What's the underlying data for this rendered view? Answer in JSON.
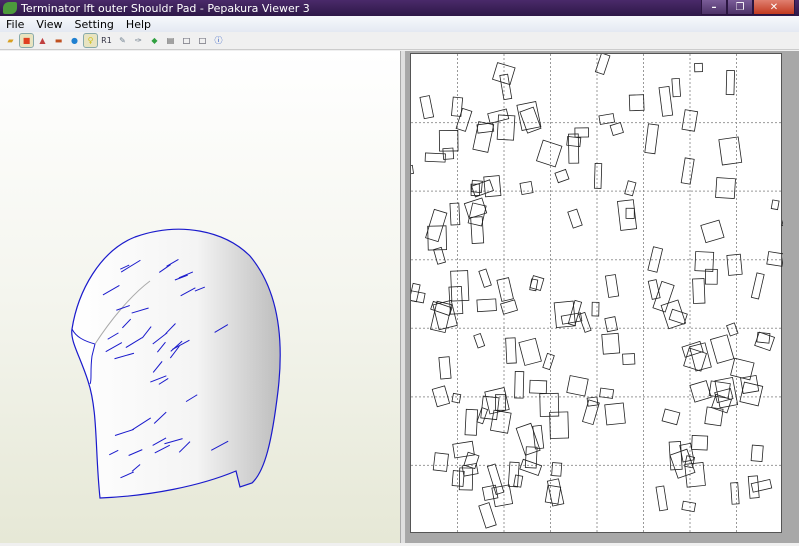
{
  "window": {
    "title": "Terminator lft outer Shouldr Pad - Pepakura Viewer 3",
    "minimize": "–",
    "maximize": "❐",
    "close": "✕"
  },
  "menu": [
    "File",
    "View",
    "Setting",
    "Help"
  ],
  "toolbar": [
    {
      "icon": "open-folder-icon",
      "glyph": "▰",
      "color": "#d9a020"
    },
    {
      "icon": "3d-view-icon",
      "glyph": "■",
      "color": "#e04020",
      "active": true
    },
    {
      "icon": "print-icon",
      "glyph": "▲",
      "color": "#c04040"
    },
    {
      "icon": "layout-icon",
      "glyph": "▬",
      "color": "#c05020"
    },
    {
      "icon": "texture-icon",
      "glyph": "●",
      "color": "#2080d0"
    },
    {
      "icon": "light-bulb-icon",
      "glyph": "♀",
      "color": "#d0c020",
      "active": true
    },
    {
      "icon": "r1-icon",
      "glyph": "R1",
      "color": "#334"
    },
    {
      "icon": "settings-icon",
      "glyph": "✎",
      "color": "#708090"
    },
    {
      "icon": "wrench-icon",
      "glyph": "✑",
      "color": "#607080"
    },
    {
      "icon": "select-icon",
      "glyph": "◆",
      "color": "#30a040"
    },
    {
      "icon": "printer-icon",
      "glyph": "▤",
      "color": "#555"
    },
    {
      "icon": "page-icon",
      "glyph": "□",
      "color": "#334"
    },
    {
      "icon": "page2-icon",
      "glyph": "□",
      "color": "#334"
    },
    {
      "icon": "info-icon",
      "glyph": "ⓘ",
      "color": "#2050c0"
    }
  ],
  "colors": {
    "edge": "#1a1acc",
    "title_bg": "#3a2058"
  }
}
